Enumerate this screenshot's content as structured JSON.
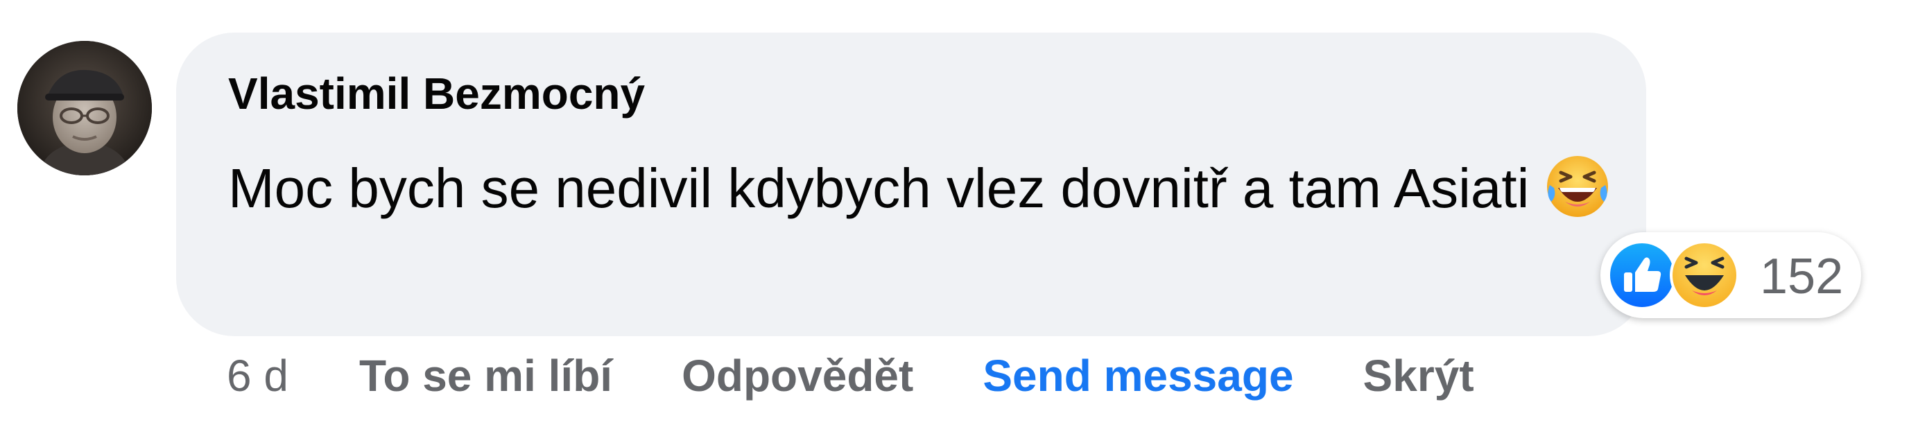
{
  "comment": {
    "author": "Vlastimil Bezmocný",
    "text": "Moc bych se nedivil kdybych vlez dovnitř a tam Asiati",
    "emoji": "face-with-tears-of-joy-icon"
  },
  "reactions": {
    "icons": [
      "like-icon",
      "haha-icon"
    ],
    "count": "152"
  },
  "actions": {
    "time": "6 d",
    "like": "To se mi líbí",
    "reply": "Odpovědět",
    "send_message": "Send message",
    "hide": "Skrýt"
  },
  "colors": {
    "bubble_bg": "#f0f2f5",
    "accent": "#1877f2",
    "secondary_text": "#65676b",
    "primary_text": "#050505",
    "like_blue": "#1877f2",
    "haha_yellow": "#f7b125"
  }
}
